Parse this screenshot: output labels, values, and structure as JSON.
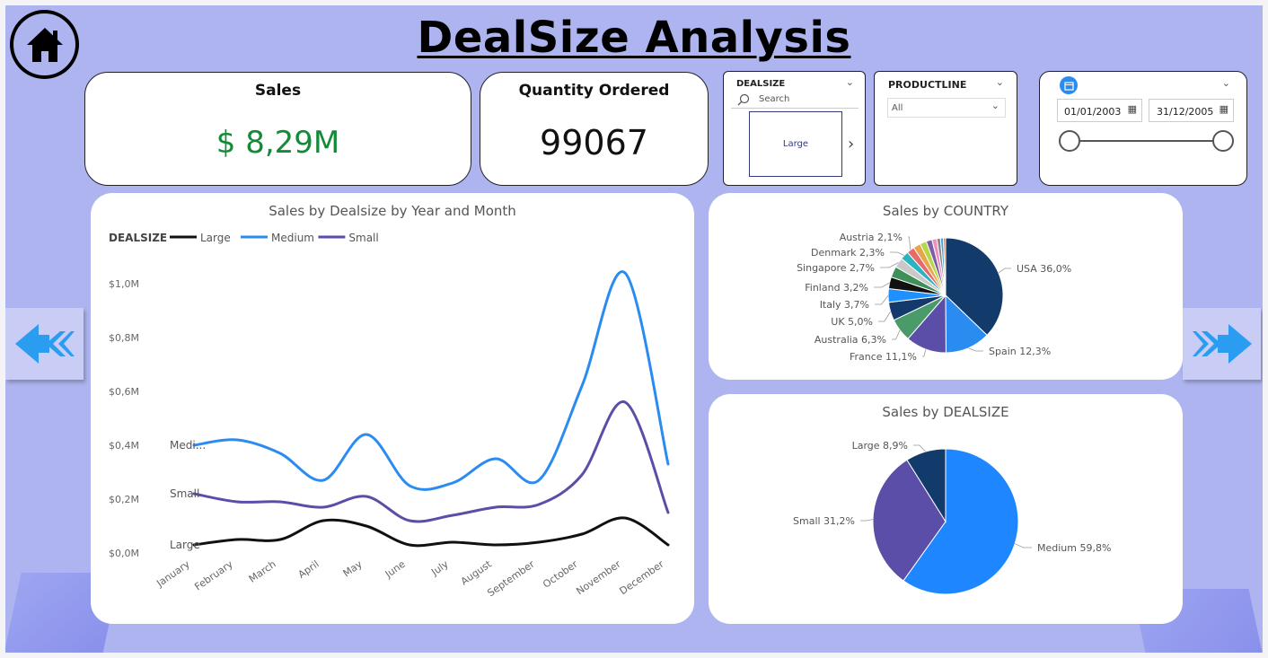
{
  "page": {
    "title": "DealSize Analysis"
  },
  "nav": {
    "home_icon": "home-icon",
    "prev_icon": "double-left-arrow-icon",
    "next_icon": "double-right-arrow-icon"
  },
  "kpis": {
    "sales": {
      "label": "Sales",
      "value": "$ 8,29M",
      "color": "#138a36"
    },
    "quantity": {
      "label": "Quantity Ordered",
      "value": "99067"
    }
  },
  "slicers": {
    "dealsize": {
      "title": "DEALSIZE",
      "search_placeholder": "Search",
      "selected": "Large"
    },
    "productline": {
      "title": "PRODUCTLINE",
      "selected": "All"
    },
    "date": {
      "start": "01/01/2003",
      "end": "31/12/2005",
      "icon": "calendar-icon",
      "accent": "#2a8cf0"
    }
  },
  "chart_data": [
    {
      "type": "line",
      "title": "Sales by Dealsize by Year and Month",
      "legend_title": "DEALSIZE",
      "legend_position": "top-left",
      "categories": [
        "January",
        "February",
        "March",
        "April",
        "May",
        "June",
        "July",
        "August",
        "September",
        "October",
        "November",
        "December"
      ],
      "series": [
        {
          "name": "Large",
          "color": "#111111",
          "values": [
            0.03,
            0.05,
            0.05,
            0.12,
            0.1,
            0.03,
            0.04,
            0.03,
            0.04,
            0.07,
            0.13,
            0.03
          ]
        },
        {
          "name": "Medium",
          "color": "#2a8cf0",
          "values": [
            0.4,
            0.42,
            0.37,
            0.27,
            0.44,
            0.25,
            0.26,
            0.35,
            0.27,
            0.62,
            1.04,
            0.33
          ]
        },
        {
          "name": "Small",
          "color": "#5b4ea8",
          "values": [
            0.22,
            0.19,
            0.19,
            0.17,
            0.21,
            0.12,
            0.14,
            0.17,
            0.18,
            0.29,
            0.56,
            0.15
          ]
        }
      ],
      "end_labels": [
        "Medi...",
        "Small",
        "Large"
      ],
      "y_ticks": [
        "$1,0M",
        "$0,8M",
        "$0,6M",
        "$0,4M",
        "$0,2M",
        "$0,0M"
      ],
      "ylim": [
        0,
        1.05
      ],
      "grid": false
    },
    {
      "type": "pie",
      "title": "Sales by COUNTRY",
      "slices": [
        {
          "label": "USA 36,0%",
          "value": 36.0,
          "color": "#123a6b"
        },
        {
          "label": "Spain 12,3%",
          "value": 12.3,
          "color": "#2a8cf0"
        },
        {
          "label": "France 11,1%",
          "value": 11.1,
          "color": "#5b4ea8"
        },
        {
          "label": "Australia 6,3%",
          "value": 6.3,
          "color": "#4b9a6a"
        },
        {
          "label": "UK 5,0%",
          "value": 5.0,
          "color": "#133a6b"
        },
        {
          "label": "Italy 3,7%",
          "value": 3.7,
          "color": "#1e90ff"
        },
        {
          "label": "Finland 3,2%",
          "value": 3.2,
          "color": "#111111"
        },
        {
          "label": "",
          "value": 3.0,
          "color": "#3f8f5a"
        },
        {
          "label": "Singapore 2,7%",
          "value": 2.7,
          "color": "#c9c9c9"
        },
        {
          "label": "Denmark 2,3%",
          "value": 2.3,
          "color": "#2bb3c0"
        },
        {
          "label": "Austria 2,1%",
          "value": 2.1,
          "color": "#e86b6b"
        },
        {
          "label": "",
          "value": 2.0,
          "color": "#e8a64a"
        },
        {
          "label": "",
          "value": 1.8,
          "color": "#b5d84a"
        },
        {
          "label": "",
          "value": 1.6,
          "color": "#7b5ea8"
        },
        {
          "label": "",
          "value": 1.3,
          "color": "#f08fbf"
        },
        {
          "label": "",
          "value": 1.0,
          "color": "#888888"
        },
        {
          "label": "",
          "value": 0.8,
          "color": "#4aa3e0"
        },
        {
          "label": "",
          "value": 0.6,
          "color": "#d98040"
        }
      ]
    },
    {
      "type": "pie",
      "title": "Sales by DEALSIZE",
      "slices": [
        {
          "label": "Medium 59,8%",
          "value": 59.8,
          "color": "#1e87ff"
        },
        {
          "label": "Small 31,2%",
          "value": 31.2,
          "color": "#5b4ea8"
        },
        {
          "label": "Large 8,9%",
          "value": 8.9,
          "color": "#123a6b"
        }
      ]
    }
  ]
}
